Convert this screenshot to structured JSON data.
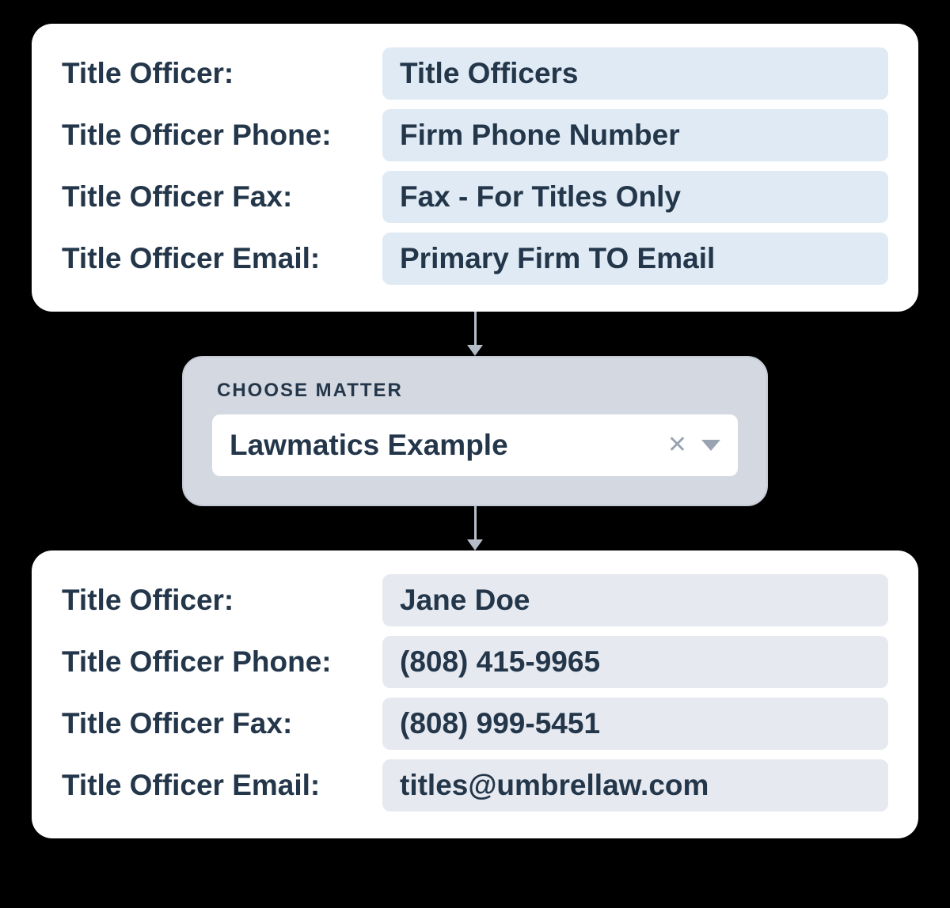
{
  "template_card": {
    "rows": [
      {
        "label": "Title Officer:",
        "value": "Title Officers"
      },
      {
        "label": "Title Officer Phone:",
        "value": "Firm Phone Number"
      },
      {
        "label": "Title Officer Fax:",
        "value": "Fax - For Titles Only"
      },
      {
        "label": "Title Officer Email:",
        "value": "Primary Firm TO Email"
      }
    ]
  },
  "matter_select": {
    "label": "CHOOSE MATTER",
    "value": "Lawmatics Example"
  },
  "result_card": {
    "rows": [
      {
        "label": "Title Officer:",
        "value": "Jane Doe"
      },
      {
        "label": "Title Officer Phone:",
        "value": "(808) 415-9965"
      },
      {
        "label": "Title Officer Fax:",
        "value": "(808) 999-5451"
      },
      {
        "label": "Title Officer Email:",
        "value": "titles@umbrellaw.com"
      }
    ]
  }
}
